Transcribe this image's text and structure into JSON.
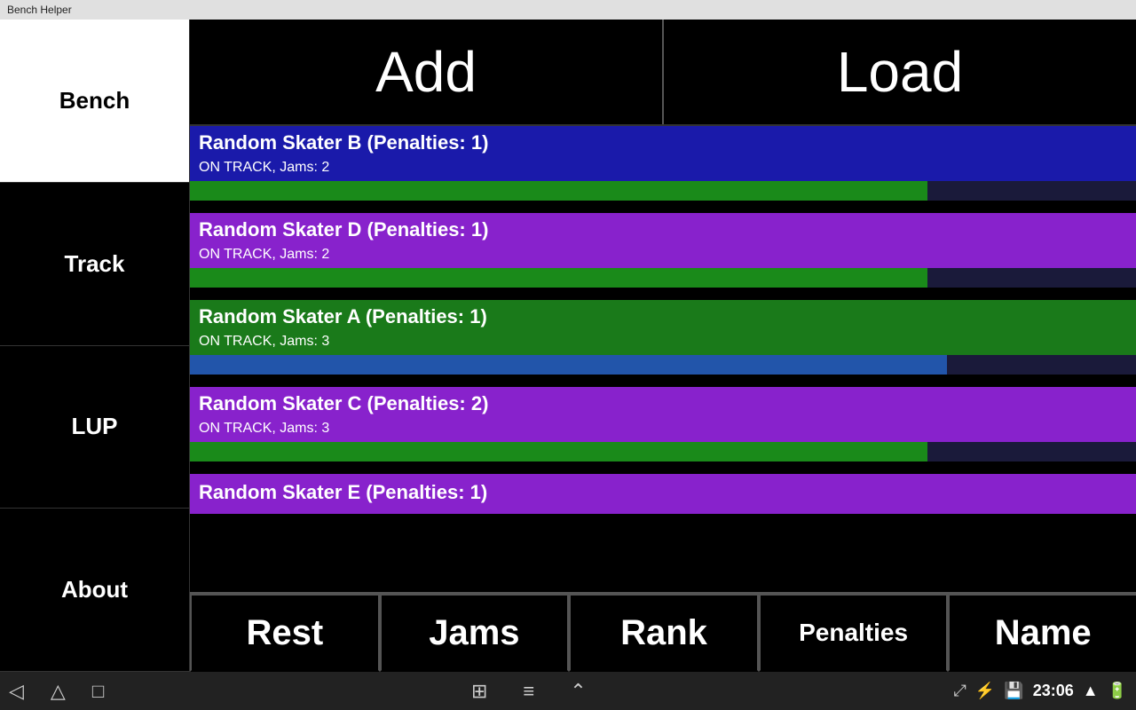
{
  "titleBar": {
    "text": "Bench Helper"
  },
  "sidebar": {
    "items": [
      {
        "id": "bench",
        "label": "Bench",
        "style": "bench"
      },
      {
        "id": "track",
        "label": "Track",
        "style": "dark"
      },
      {
        "id": "lup",
        "label": "LUP",
        "style": "dark"
      },
      {
        "id": "about",
        "label": "About",
        "style": "dark"
      }
    ]
  },
  "topButtons": {
    "add": "Add",
    "load": "Load"
  },
  "skaters": [
    {
      "id": "b",
      "name": "Random Skater B (Penalties: 1)",
      "status": "ON TRACK, Jams: 2",
      "bg": "blue",
      "barPercent": 78
    },
    {
      "id": "d",
      "name": "Random Skater D (Penalties: 1)",
      "status": "ON TRACK, Jams: 2",
      "bg": "purple",
      "barPercent": 78
    },
    {
      "id": "a",
      "name": "Random Skater A (Penalties: 1)",
      "status": "ON TRACK, Jams: 3",
      "bg": "green",
      "barPercent": 80
    },
    {
      "id": "c",
      "name": "Random Skater C (Penalties: 2)",
      "status": "ON TRACK, Jams: 3",
      "bg": "purple",
      "barPercent": 78
    },
    {
      "id": "e",
      "name": "Random Skater E (Penalties: 1)",
      "status": "",
      "bg": "purple",
      "barPercent": 0,
      "partial": true
    }
  ],
  "sortBar": {
    "buttons": [
      "Rest",
      "Jams",
      "Rank",
      "Penalties",
      "Name"
    ]
  },
  "bottomBar": {
    "time": "23:06",
    "navIcons": [
      "◁",
      "△",
      "□",
      "⊞",
      "≡",
      "⌃"
    ]
  }
}
